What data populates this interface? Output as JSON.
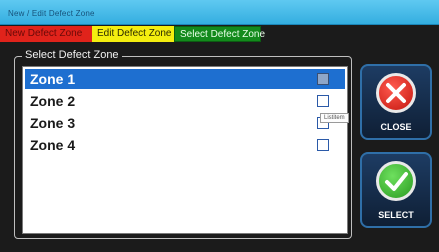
{
  "window": {
    "title": "New / Edit Defect Zone"
  },
  "tabs": [
    {
      "label": "New Defect Zone"
    },
    {
      "label": "Edit Defect Zone"
    },
    {
      "label": "Select Defect Zone"
    }
  ],
  "group": {
    "title": "Select Defect Zone"
  },
  "zones": [
    {
      "label": "Zone 1",
      "selected": true,
      "checked": false
    },
    {
      "label": "Zone 2",
      "selected": false,
      "checked": false
    },
    {
      "label": "Zone 3",
      "selected": false,
      "checked": false
    },
    {
      "label": "Zone 4",
      "selected": false,
      "checked": false
    }
  ],
  "tooltip": {
    "text": "Listitem"
  },
  "buttons": {
    "close": {
      "label": "CLOSE",
      "icon": "x-circle-icon",
      "color": "#e0231b"
    },
    "select": {
      "label": "SELECT",
      "icon": "checkmark-circle-icon",
      "color": "#2a9a20"
    }
  }
}
